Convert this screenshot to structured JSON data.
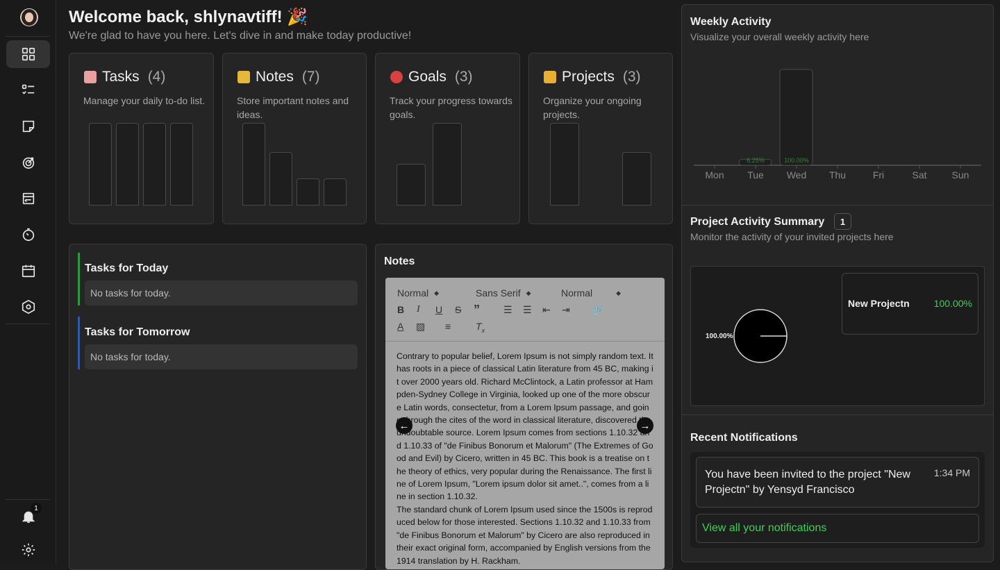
{
  "sidebar": {
    "notification_count": "1",
    "items": [
      "dashboard",
      "tasks",
      "notes",
      "goals",
      "projects",
      "pomodoro",
      "calendar",
      "settings-hub"
    ]
  },
  "header": {
    "title": "Welcome back, shlynavtiff! 🎉",
    "subtitle": "We're glad to have you here. Let's dive in and make today productive!"
  },
  "cards": [
    {
      "name": "Tasks",
      "count": "(4)",
      "desc": "Manage your daily to-do list.",
      "emoji_color": "#e8a0a0",
      "bars": [
        1,
        1,
        1,
        1
      ]
    },
    {
      "name": "Notes",
      "count": "(7)",
      "desc": "Store important notes and ideas.",
      "emoji_color": "#e5b83a",
      "bars": [
        4,
        2.6,
        1.3,
        1.3
      ]
    },
    {
      "name": "Goals",
      "count": "(3)",
      "desc": "Track your progress towards goals.",
      "emoji_color": "#d94040",
      "bars": [
        1,
        2
      ]
    },
    {
      "name": "Projects",
      "count": "(3)",
      "desc": "Organize your ongoing projects.",
      "emoji_color": "#e8b030",
      "bars": [
        2,
        1.3
      ]
    }
  ],
  "today": {
    "title": "Tasks for Today",
    "empty": "No tasks for today.",
    "accent": "#2e9a3e"
  },
  "tomorrow": {
    "title": "Tasks for Tomorrow",
    "empty": "No tasks for today.",
    "accent": "#2e5aa8"
  },
  "notes": {
    "title": "Notes",
    "toolbar": {
      "heading": "Normal",
      "font": "Sans Serif",
      "size": "Normal"
    },
    "content": "Contrary to popular belief, Lorem Ipsum is not simply random text. It has roots in a piece of classical Latin literature from 45 BC, making it over 2000 years old. Richard McClintock, a Latin professor at Hampden-Sydney College in Virginia, looked up one of the more obscure Latin words, consectetur, from a Lorem Ipsum passage, and going through the cites of the word in classical literature, discovered the undoubtable source. Lorem Ipsum comes from sections 1.10.32 and 1.10.33 of \"de Finibus Bonorum et Malorum\" (The Extremes of Good and Evil) by Cicero, written in 45 BC. This book is a treatise on the theory of ethics, very popular during the Renaissance. The first line of Lorem Ipsum, \"Lorem ipsum dolor sit amet..\", comes from a line in section 1.10.32.",
    "content2": "The standard chunk of Lorem Ipsum used since the 1500s is reproduced below for those interested. Sections 1.10.32 and 1.10.33 from \"de Finibus Bonorum et Malorum\" by Cicero are also reproduced in their exact original form, accompanied by English versions from the 1914 translation by H. Rackham."
  },
  "weekly": {
    "title": "Weekly Activity",
    "subtitle": "Visualize your overall weekly activity here",
    "chart_data": {
      "type": "bar",
      "categories": [
        "Mon",
        "Tue",
        "Wed",
        "Thu",
        "Fri",
        "Sat",
        "Sun"
      ],
      "values": [
        0,
        6.25,
        100,
        0,
        0,
        0,
        0
      ],
      "labels": [
        "",
        "6.25%",
        "100.00%",
        "",
        "",
        "",
        ""
      ],
      "ylim": [
        0,
        100
      ]
    }
  },
  "project_summary": {
    "title": "Project Activity Summary",
    "count": "1",
    "subtitle": "Monitor the activity of your invited projects here",
    "pie_label": "100.00%",
    "legend_name": "New Projectn",
    "legend_value": "100.00%",
    "accent": "#3ecf5a"
  },
  "notifications": {
    "title": "Recent Notifications",
    "message": "You have been invited to the project \"New Projectn\" by Yensyd Francisco",
    "time": "1:34 PM",
    "view_all": "View all your notifications"
  }
}
